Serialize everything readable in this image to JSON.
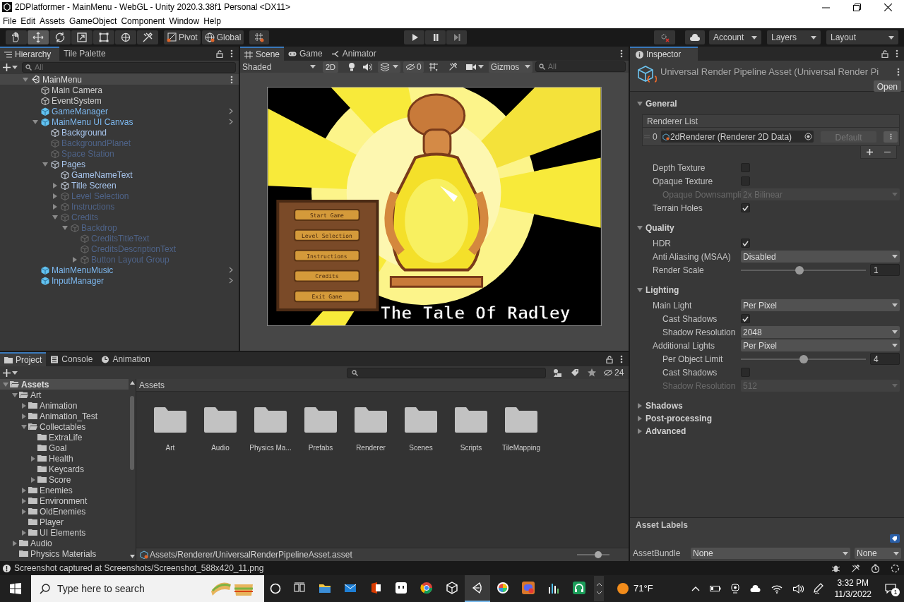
{
  "window": {
    "title": "2DPlatformer - MainMenu - WebGL - Unity 2020.3.38f1 Personal <DX11>"
  },
  "menu": [
    "File",
    "Edit",
    "Assets",
    "GameObject",
    "Component",
    "Window",
    "Help"
  ],
  "toolbar": {
    "tools": [
      {
        "kind": "hand",
        "selected": false
      },
      {
        "kind": "move",
        "selected": true
      },
      {
        "kind": "rotate",
        "selected": false
      },
      {
        "kind": "scale",
        "selected": false
      },
      {
        "kind": "rect",
        "selected": false
      },
      {
        "kind": "transform",
        "selected": false
      },
      {
        "kind": "custom",
        "selected": false
      }
    ],
    "pivot": "Pivot",
    "space": "Global",
    "playback": [
      {
        "kind": "play"
      },
      {
        "kind": "pause"
      },
      {
        "kind": "step"
      }
    ],
    "account": "Account",
    "layers": "Layers",
    "layout": "Layout"
  },
  "hierarchy": {
    "tabs": [
      {
        "label": "Hierarchy",
        "selected": true
      },
      {
        "label": "Tile Palette",
        "selected": false
      }
    ],
    "search_placeholder": "All",
    "tree": [
      {
        "label": "MainMenu",
        "kind": "scene",
        "active": true,
        "expanded": true,
        "children": [
          {
            "label": "Main Camera",
            "kind": "object",
            "active": true
          },
          {
            "label": "EventSystem",
            "kind": "object",
            "active": true
          },
          {
            "label": "GameManager",
            "kind": "prefab",
            "active": true
          },
          {
            "label": "MainMenu UI Canvas",
            "kind": "prefab",
            "active": true,
            "expanded": true,
            "children": [
              {
                "label": "Background",
                "kind": "prefab-child",
                "active": true
              },
              {
                "label": "BackgroundPlanet",
                "kind": "prefab-child",
                "active": false
              },
              {
                "label": "Space Station",
                "kind": "prefab-child",
                "active": false
              },
              {
                "label": "Pages",
                "kind": "prefab-child",
                "active": true,
                "expanded": true,
                "children": [
                  {
                    "label": "GameNameText",
                    "kind": "prefab-child",
                    "active": true
                  },
                  {
                    "label": "Title Screen",
                    "kind": "prefab-child",
                    "active": true,
                    "expanded": false
                  },
                  {
                    "label": "Level Selection",
                    "kind": "prefab-child",
                    "active": false,
                    "expanded": false
                  },
                  {
                    "label": "Instructions",
                    "kind": "prefab-child",
                    "active": false,
                    "expanded": false
                  },
                  {
                    "label": "Credits",
                    "kind": "prefab-child",
                    "active": false,
                    "expanded": true,
                    "children": [
                      {
                        "label": "Backdrop",
                        "kind": "prefab-child",
                        "active": false,
                        "expanded": true,
                        "children": [
                          {
                            "label": "CreditsTitleText",
                            "kind": "prefab-child",
                            "active": false
                          },
                          {
                            "label": "CreditsDescriptionText",
                            "kind": "prefab-child",
                            "active": false
                          },
                          {
                            "label": "Button Layout Group",
                            "kind": "prefab-child",
                            "active": false,
                            "expanded": false
                          }
                        ]
                      }
                    ]
                  }
                ]
              }
            ]
          },
          {
            "label": "MainMenuMusic",
            "kind": "prefab",
            "active": true
          },
          {
            "label": "InputManager",
            "kind": "prefab",
            "active": true
          }
        ]
      }
    ]
  },
  "scene": {
    "tabs": [
      {
        "label": "Scene",
        "kind": "scene",
        "selected": true
      },
      {
        "label": "Game",
        "kind": "game",
        "selected": false
      },
      {
        "label": "Animator",
        "kind": "animator",
        "selected": false
      }
    ],
    "shading": "Shaded",
    "mode_2d": {
      "label": "2D",
      "on": true
    },
    "hidden_count": "0",
    "gizmos": "Gizmos",
    "search_placeholder": "All",
    "game_view": {
      "menu_buttons": [
        "Start Game",
        "Level Selection",
        "Instructions",
        "Credits",
        "Exit Game"
      ],
      "title": "The Tale Of Radley"
    }
  },
  "project": {
    "tabs": [
      {
        "label": "Project",
        "kind": "project",
        "selected": true
      },
      {
        "label": "Console",
        "kind": "console",
        "selected": false
      },
      {
        "label": "Animation",
        "kind": "animation",
        "selected": false
      }
    ],
    "hidden_count": "24",
    "tree": [
      {
        "label": "Assets",
        "selected": true,
        "expanded": true,
        "children": [
          {
            "label": "Art",
            "selected": false,
            "expanded": true,
            "children": [
              {
                "label": "Animation",
                "selected": false,
                "expanded": false
              },
              {
                "label": "Animation_Test",
                "selected": false,
                "expanded": false
              },
              {
                "label": "Collectables",
                "selected": false,
                "expanded": true,
                "children": [
                  {
                    "label": "ExtraLife",
                    "selected": false
                  },
                  {
                    "label": "Goal",
                    "selected": false
                  },
                  {
                    "label": "Health",
                    "selected": false,
                    "expanded": false
                  },
                  {
                    "label": "Keycards",
                    "selected": false
                  },
                  {
                    "label": "Score",
                    "selected": false,
                    "expanded": false
                  }
                ]
              },
              {
                "label": "Enemies",
                "selected": false,
                "expanded": false
              },
              {
                "label": "Environment",
                "selected": false,
                "expanded": false
              },
              {
                "label": "OldEnemies",
                "selected": false,
                "expanded": false
              },
              {
                "label": "Player",
                "selected": false
              },
              {
                "label": "UI Elements",
                "selected": false,
                "expanded": false
              }
            ]
          },
          {
            "label": "Audio",
            "selected": false,
            "expanded": false
          },
          {
            "label": "Physics Materials",
            "selected": false
          }
        ]
      }
    ],
    "breadcrumb": "Assets",
    "items": [
      "Art",
      "Audio",
      "Physics Ma...",
      "Prefabs",
      "Renderer",
      "Scenes",
      "Scripts",
      "TileMapping"
    ],
    "path": "Assets/Renderer/UniversalRenderPipelineAsset.asset",
    "zoom": {
      "level": 0.65
    }
  },
  "inspector": {
    "tab": "Inspector",
    "title": "Universal Render Pipeline Asset (Universal Render Pi",
    "open_button": "Open",
    "sections": [
      {
        "title": "General",
        "expanded": true,
        "renderer_list": {
          "header": "Renderer List",
          "items": [
            {
              "index": "0",
              "name": "2dRenderer (Renderer 2D Data)",
              "button": "Default"
            }
          ]
        },
        "properties": [
          {
            "label": "Depth Texture",
            "kind": "checkbox",
            "checked": false,
            "disabled": false
          },
          {
            "label": "Opaque Texture",
            "kind": "checkbox",
            "checked": false,
            "disabled": false,
            "children": [
              {
                "label": "Opaque Downsampli",
                "kind": "dropdown",
                "value": "2x Bilinear",
                "disabled": true
              }
            ]
          },
          {
            "label": "Terrain Holes",
            "kind": "checkbox",
            "checked": true,
            "disabled": false
          }
        ]
      },
      {
        "title": "Quality",
        "expanded": true,
        "properties": [
          {
            "label": "HDR",
            "kind": "checkbox",
            "checked": true,
            "disabled": false
          },
          {
            "label": "Anti Aliasing (MSAA)",
            "kind": "dropdown",
            "value": "Disabled",
            "disabled": false
          },
          {
            "label": "Render Scale",
            "kind": "slider",
            "level": 0.47,
            "value": "1",
            "disabled": false
          }
        ]
      },
      {
        "title": "Lighting",
        "expanded": true,
        "properties": [
          {
            "label": "Main Light",
            "kind": "dropdown",
            "value": "Per Pixel",
            "disabled": false,
            "children": [
              {
                "label": "Cast Shadows",
                "kind": "checkbox",
                "checked": true,
                "disabled": false
              },
              {
                "label": "Shadow Resolution",
                "kind": "dropdown",
                "value": "2048",
                "disabled": false
              }
            ]
          },
          {
            "label": "Additional Lights",
            "kind": "dropdown",
            "value": "Per Pixel",
            "disabled": false,
            "children": [
              {
                "label": "Per Object Limit",
                "kind": "slider",
                "level": 0.5,
                "value": "4",
                "disabled": false
              },
              {
                "label": "Cast Shadows",
                "kind": "checkbox",
                "checked": false,
                "disabled": false
              },
              {
                "label": "Shadow Resolution",
                "kind": "dropdown",
                "value": "512",
                "disabled": true
              }
            ]
          }
        ]
      },
      {
        "title": "Shadows",
        "expanded": false
      },
      {
        "title": "Post-processing",
        "expanded": false
      },
      {
        "title": "Advanced",
        "expanded": false
      }
    ],
    "asset_labels": "Asset Labels",
    "asset_bundle": {
      "label": "AssetBundle",
      "name": "None",
      "variant": "None"
    }
  },
  "status_bar": {
    "message": "Screenshot captured at Screenshots/Screenshot_588x420_11.png"
  },
  "taskbar": {
    "search_placeholder": "Type here to search",
    "apps": [
      {
        "kind": "task-view",
        "selected": false
      },
      {
        "kind": "explorer",
        "selected": false
      },
      {
        "kind": "mail",
        "selected": false
      },
      {
        "kind": "office",
        "selected": false
      },
      {
        "kind": "app",
        "selected": false
      },
      {
        "kind": "browser",
        "selected": false
      },
      {
        "kind": "hub",
        "selected": false
      },
      {
        "kind": "editor",
        "selected": true
      },
      {
        "kind": "color",
        "selected": false
      },
      {
        "kind": "chat",
        "selected": false
      },
      {
        "kind": "chart",
        "selected": false
      },
      {
        "kind": "headset",
        "selected": false
      }
    ],
    "weather": "71°F",
    "time": "3:32 PM",
    "date": "11/3/2022",
    "notifications": "1"
  }
}
